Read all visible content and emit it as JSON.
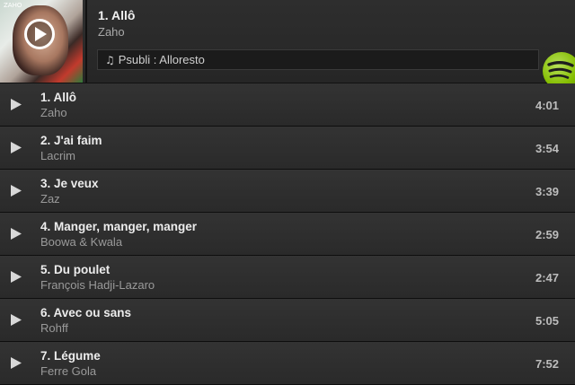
{
  "now_playing": {
    "title": "1. Allô",
    "artist": "Zaho",
    "context_label": "Psubli : Alloresto",
    "cover_tag": "ZAHO"
  },
  "tracks": [
    {
      "title": "1. Allô",
      "artist": "Zaho",
      "duration": "4:01"
    },
    {
      "title": "2. J'ai faim",
      "artist": "Lacrim",
      "duration": "3:54"
    },
    {
      "title": "3. Je veux",
      "artist": "Zaz",
      "duration": "3:39"
    },
    {
      "title": "4. Manger, manger, manger",
      "artist": "Boowa & Kwala",
      "duration": "2:59"
    },
    {
      "title": "5. Du poulet",
      "artist": "François Hadji-Lazaro",
      "duration": "2:47"
    },
    {
      "title": "6. Avec ou sans",
      "artist": "Rohff",
      "duration": "5:05"
    },
    {
      "title": "7. Légume",
      "artist": "Ferre Gola",
      "duration": "7:52"
    }
  ],
  "colors": {
    "spotify_green": "#84bd00",
    "background": "#2d2d2d"
  },
  "icons": {
    "play": "play-icon",
    "note": "music-note-icon",
    "brand": "spotify-logo"
  }
}
